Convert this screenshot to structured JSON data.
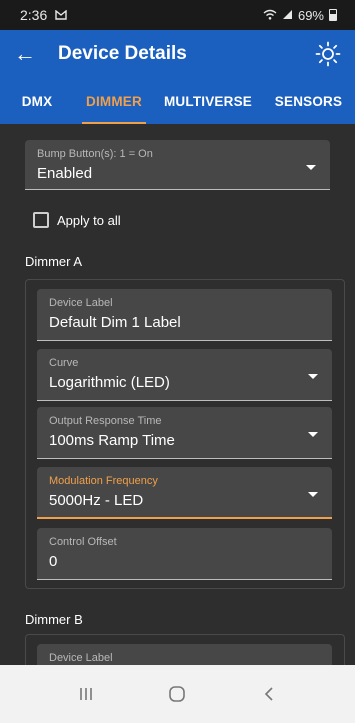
{
  "status_bar": {
    "time": "2:36",
    "battery": "69%"
  },
  "app_bar": {
    "back_symbol": "←",
    "title": "Device Details"
  },
  "tabs": [
    {
      "label": "DMX",
      "active": false
    },
    {
      "label": "DIMMER",
      "active": true
    },
    {
      "label": "MULTIVERSE",
      "active": false
    },
    {
      "label": "SENSORS",
      "active": false
    }
  ],
  "bump": {
    "label": "Bump Button(s): 1 = On",
    "value": "Enabled"
  },
  "apply_all": {
    "label": "Apply to all",
    "checked": false
  },
  "dimmer_a": {
    "title": "Dimmer A",
    "device_label": {
      "label": "Device Label",
      "value": "Default Dim 1 Label"
    },
    "curve": {
      "label": "Curve",
      "value": "Logarithmic (LED)"
    },
    "output_response": {
      "label": "Output Response Time",
      "value": "100ms Ramp Time"
    },
    "modulation": {
      "label": "Modulation Frequency",
      "value": "5000Hz - LED"
    },
    "control_offset": {
      "label": "Control Offset",
      "value": "0"
    }
  },
  "dimmer_b": {
    "title": "Dimmer B",
    "device_label": {
      "label": "Device Label"
    }
  },
  "colors": {
    "primary": "#1b5fbf",
    "accent": "#f0a04b",
    "background": "#2e2e2e",
    "field": "#474747"
  },
  "icons": {
    "back": "arrow-left-icon",
    "brightness": "sun-icon",
    "message": "message-icon",
    "wifi": "wifi-icon",
    "signal": "signal-icon",
    "battery": "battery-icon"
  }
}
